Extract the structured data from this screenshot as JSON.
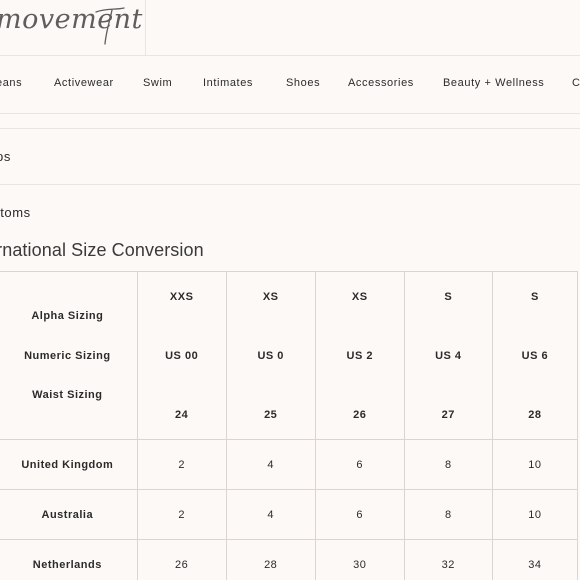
{
  "header": {
    "logo_text": "movement"
  },
  "nav": {
    "items": [
      "eans",
      "Activewear",
      "Swim",
      "Intimates",
      "Shoes",
      "Accessories",
      "Beauty + Wellness",
      "C"
    ]
  },
  "accordions": {
    "tops_label": "ps",
    "bottoms_label": "ttoms"
  },
  "section": {
    "title": "ernational Size Conversion"
  },
  "table": {
    "row_labels": {
      "alpha": "Alpha Sizing",
      "numeric": "Numeric Sizing",
      "waist": "Waist Sizing"
    },
    "columns": [
      {
        "alpha": "XXS",
        "numeric": "US 00",
        "waist": "24"
      },
      {
        "alpha": "XS",
        "numeric": "US 0",
        "waist": "25"
      },
      {
        "alpha": "XS",
        "numeric": "US 2",
        "waist": "26"
      },
      {
        "alpha": "S",
        "numeric": "US 4",
        "waist": "27"
      },
      {
        "alpha": "S",
        "numeric": "US 6",
        "waist": "28"
      }
    ],
    "rows": [
      {
        "label": "United Kingdom",
        "values": [
          "2",
          "4",
          "6",
          "8",
          "10"
        ]
      },
      {
        "label": "Australia",
        "values": [
          "2",
          "4",
          "6",
          "8",
          "10"
        ]
      },
      {
        "label": "Netherlands",
        "values": [
          "26",
          "28",
          "30",
          "32",
          "34"
        ]
      }
    ]
  }
}
